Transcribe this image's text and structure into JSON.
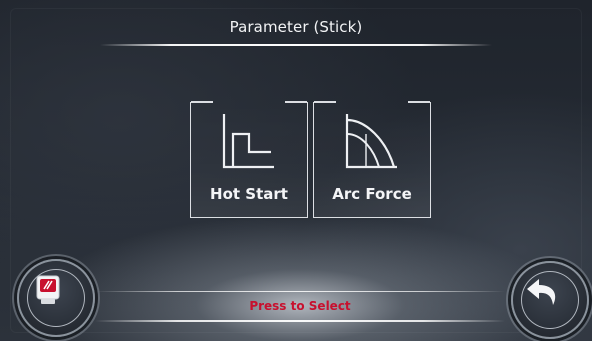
{
  "header": {
    "title": "Parameter (Stick)"
  },
  "options": [
    {
      "label": "Hot Start",
      "icon": "hot-start-icon"
    },
    {
      "label": "Arc Force",
      "icon": "arc-force-icon"
    }
  ],
  "footer": {
    "hint": "Press to Select",
    "device_icon": "welder-device-icon",
    "back_icon": "back-arrow-icon"
  },
  "colors": {
    "accent": "#c8102e",
    "text": "#f2f3f5",
    "background": "#252b34"
  }
}
